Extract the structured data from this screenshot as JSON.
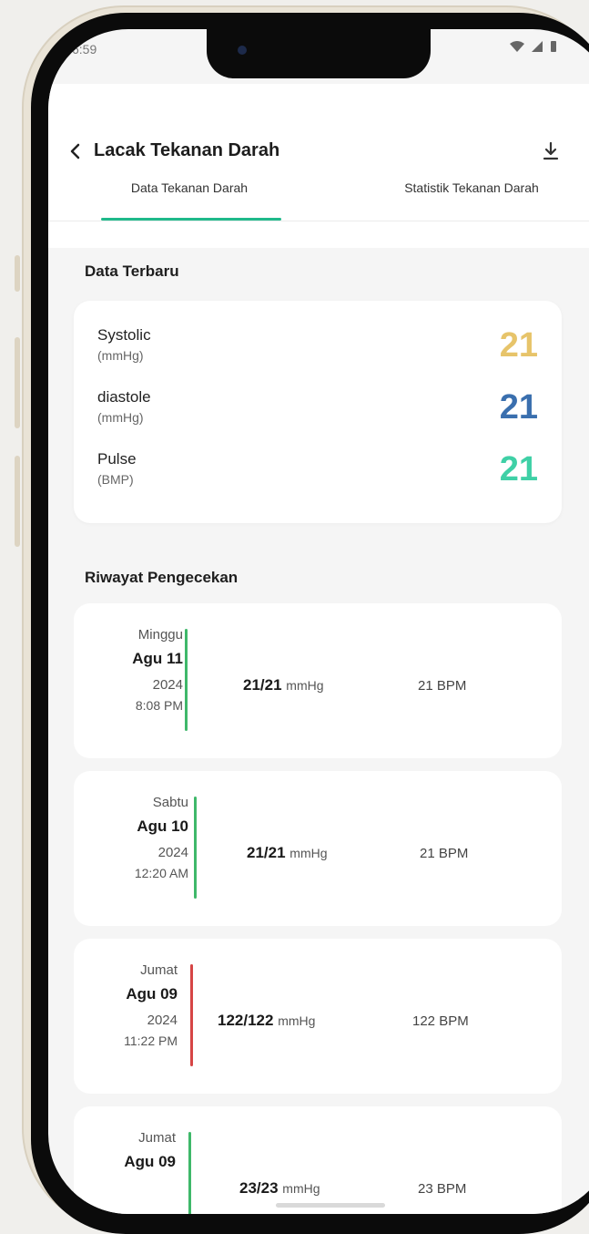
{
  "status_bar": {
    "time": "6:59"
  },
  "header": {
    "title": "Lacak Tekanan Darah",
    "back_icon": "chevron-left-icon",
    "download_icon": "download-icon"
  },
  "tabs": [
    {
      "label": "Data Tekanan Darah",
      "active": true
    },
    {
      "label": "Statistik Tekanan Darah",
      "active": false
    }
  ],
  "latest": {
    "section_title": "Data Terbaru",
    "items": [
      {
        "label": "Systolic",
        "unit": "(mmHg)",
        "value": "21",
        "color": "#e7c46a"
      },
      {
        "label": "diastole",
        "unit": "(mmHg)",
        "value": "21",
        "color": "#3a6fae"
      },
      {
        "label": "Pulse",
        "unit": "(BMP)",
        "value": "21",
        "color": "#3fd0a6"
      }
    ]
  },
  "history": {
    "section_title": "Riwayat Pengecekan",
    "items": [
      {
        "day": "Minggu",
        "date": "Agu 11",
        "year": "2024",
        "time": "8:08 PM",
        "bp": "21/21",
        "bp_unit": "mmHg",
        "pulse": "21 BPM",
        "status_color": "#3fb86a"
      },
      {
        "day": "Sabtu",
        "date": "Agu 10",
        "year": "2024",
        "time": "12:20 AM",
        "bp": "21/21",
        "bp_unit": "mmHg",
        "pulse": "21 BPM",
        "status_color": "#3fb86a"
      },
      {
        "day": "Jumat",
        "date": "Agu 09",
        "year": "2024",
        "time": "11:22 PM",
        "bp": "122/122",
        "bp_unit": "mmHg",
        "pulse": "122 BPM",
        "status_color": "#d64545"
      },
      {
        "day": "Jumat",
        "date": "Agu 09",
        "year": "",
        "time": "",
        "bp": "23/23",
        "bp_unit": "mmHg",
        "pulse": "23 BPM",
        "status_color": "#3fb86a"
      }
    ]
  }
}
